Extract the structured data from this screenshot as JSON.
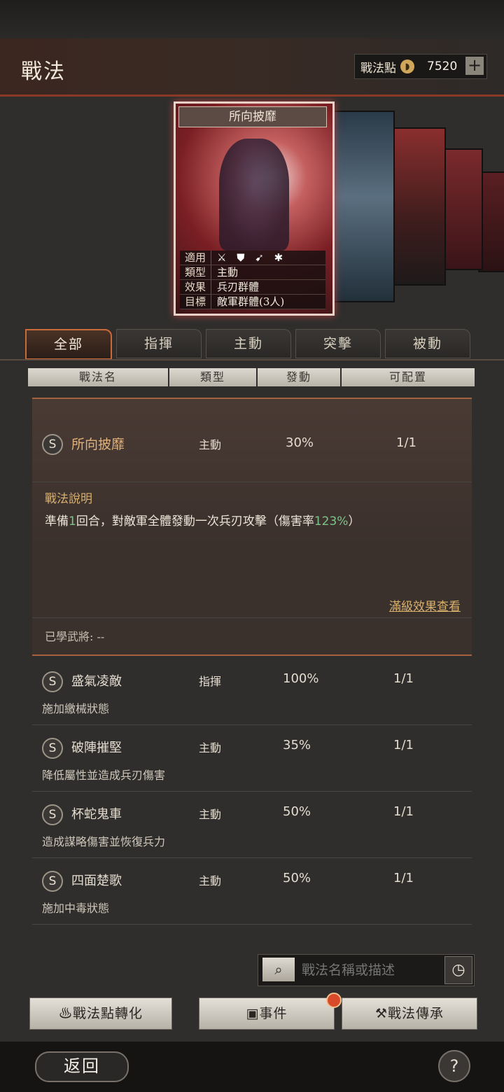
{
  "header": {
    "title": "戰法",
    "points_label": "戰法點",
    "points_value": "7520",
    "plus": "+"
  },
  "card": {
    "name": "所向披靡",
    "props": [
      {
        "k": "適用",
        "v": ""
      },
      {
        "k": "類型",
        "v": "主動"
      },
      {
        "k": "效果",
        "v": "兵刃群體"
      },
      {
        "k": "目標",
        "v": "敵軍群體(3人)"
      }
    ],
    "icons": [
      "axe-icon",
      "shield-icon",
      "bow-icon",
      "wheel-icon"
    ]
  },
  "tabs": [
    "全部",
    "指揮",
    "主動",
    "突擊",
    "被動"
  ],
  "columns": [
    "戰法名",
    "類型",
    "發動",
    "可配置"
  ],
  "selected": {
    "badge": "S",
    "name": "所向披靡",
    "type": "主動",
    "pct": "30%",
    "conf": "1/1",
    "desc_title": "戰法說明",
    "desc_pre": "準備",
    "desc_num": "1",
    "desc_mid": "回合，對敵軍全體發動一次兵刃攻擊（傷害率",
    "desc_rate": "123%",
    "desc_post": "）",
    "full_link": "滿級效果查看",
    "learned": "已學武將: --"
  },
  "items": [
    {
      "badge": "S",
      "name": "盛氣凌敵",
      "type": "指揮",
      "pct": "100%",
      "conf": "1/1",
      "desc": "施加繳械狀態"
    },
    {
      "badge": "S",
      "name": "破陣摧堅",
      "type": "主動",
      "pct": "35%",
      "conf": "1/1",
      "desc": "降低屬性並造成兵刃傷害"
    },
    {
      "badge": "S",
      "name": "杯蛇鬼車",
      "type": "主動",
      "pct": "50%",
      "conf": "1/1",
      "desc": "造成謀略傷害並恢復兵力"
    },
    {
      "badge": "S",
      "name": "四面楚歌",
      "type": "主動",
      "pct": "50%",
      "conf": "1/1",
      "desc": "施加中毒狀態"
    }
  ],
  "search": {
    "placeholder": "戰法名稱或描述"
  },
  "buttons": {
    "convert": "戰法點轉化",
    "event": "事件",
    "inherit": "戰法傳承"
  },
  "bottom": {
    "back": "返回",
    "help": "?"
  }
}
